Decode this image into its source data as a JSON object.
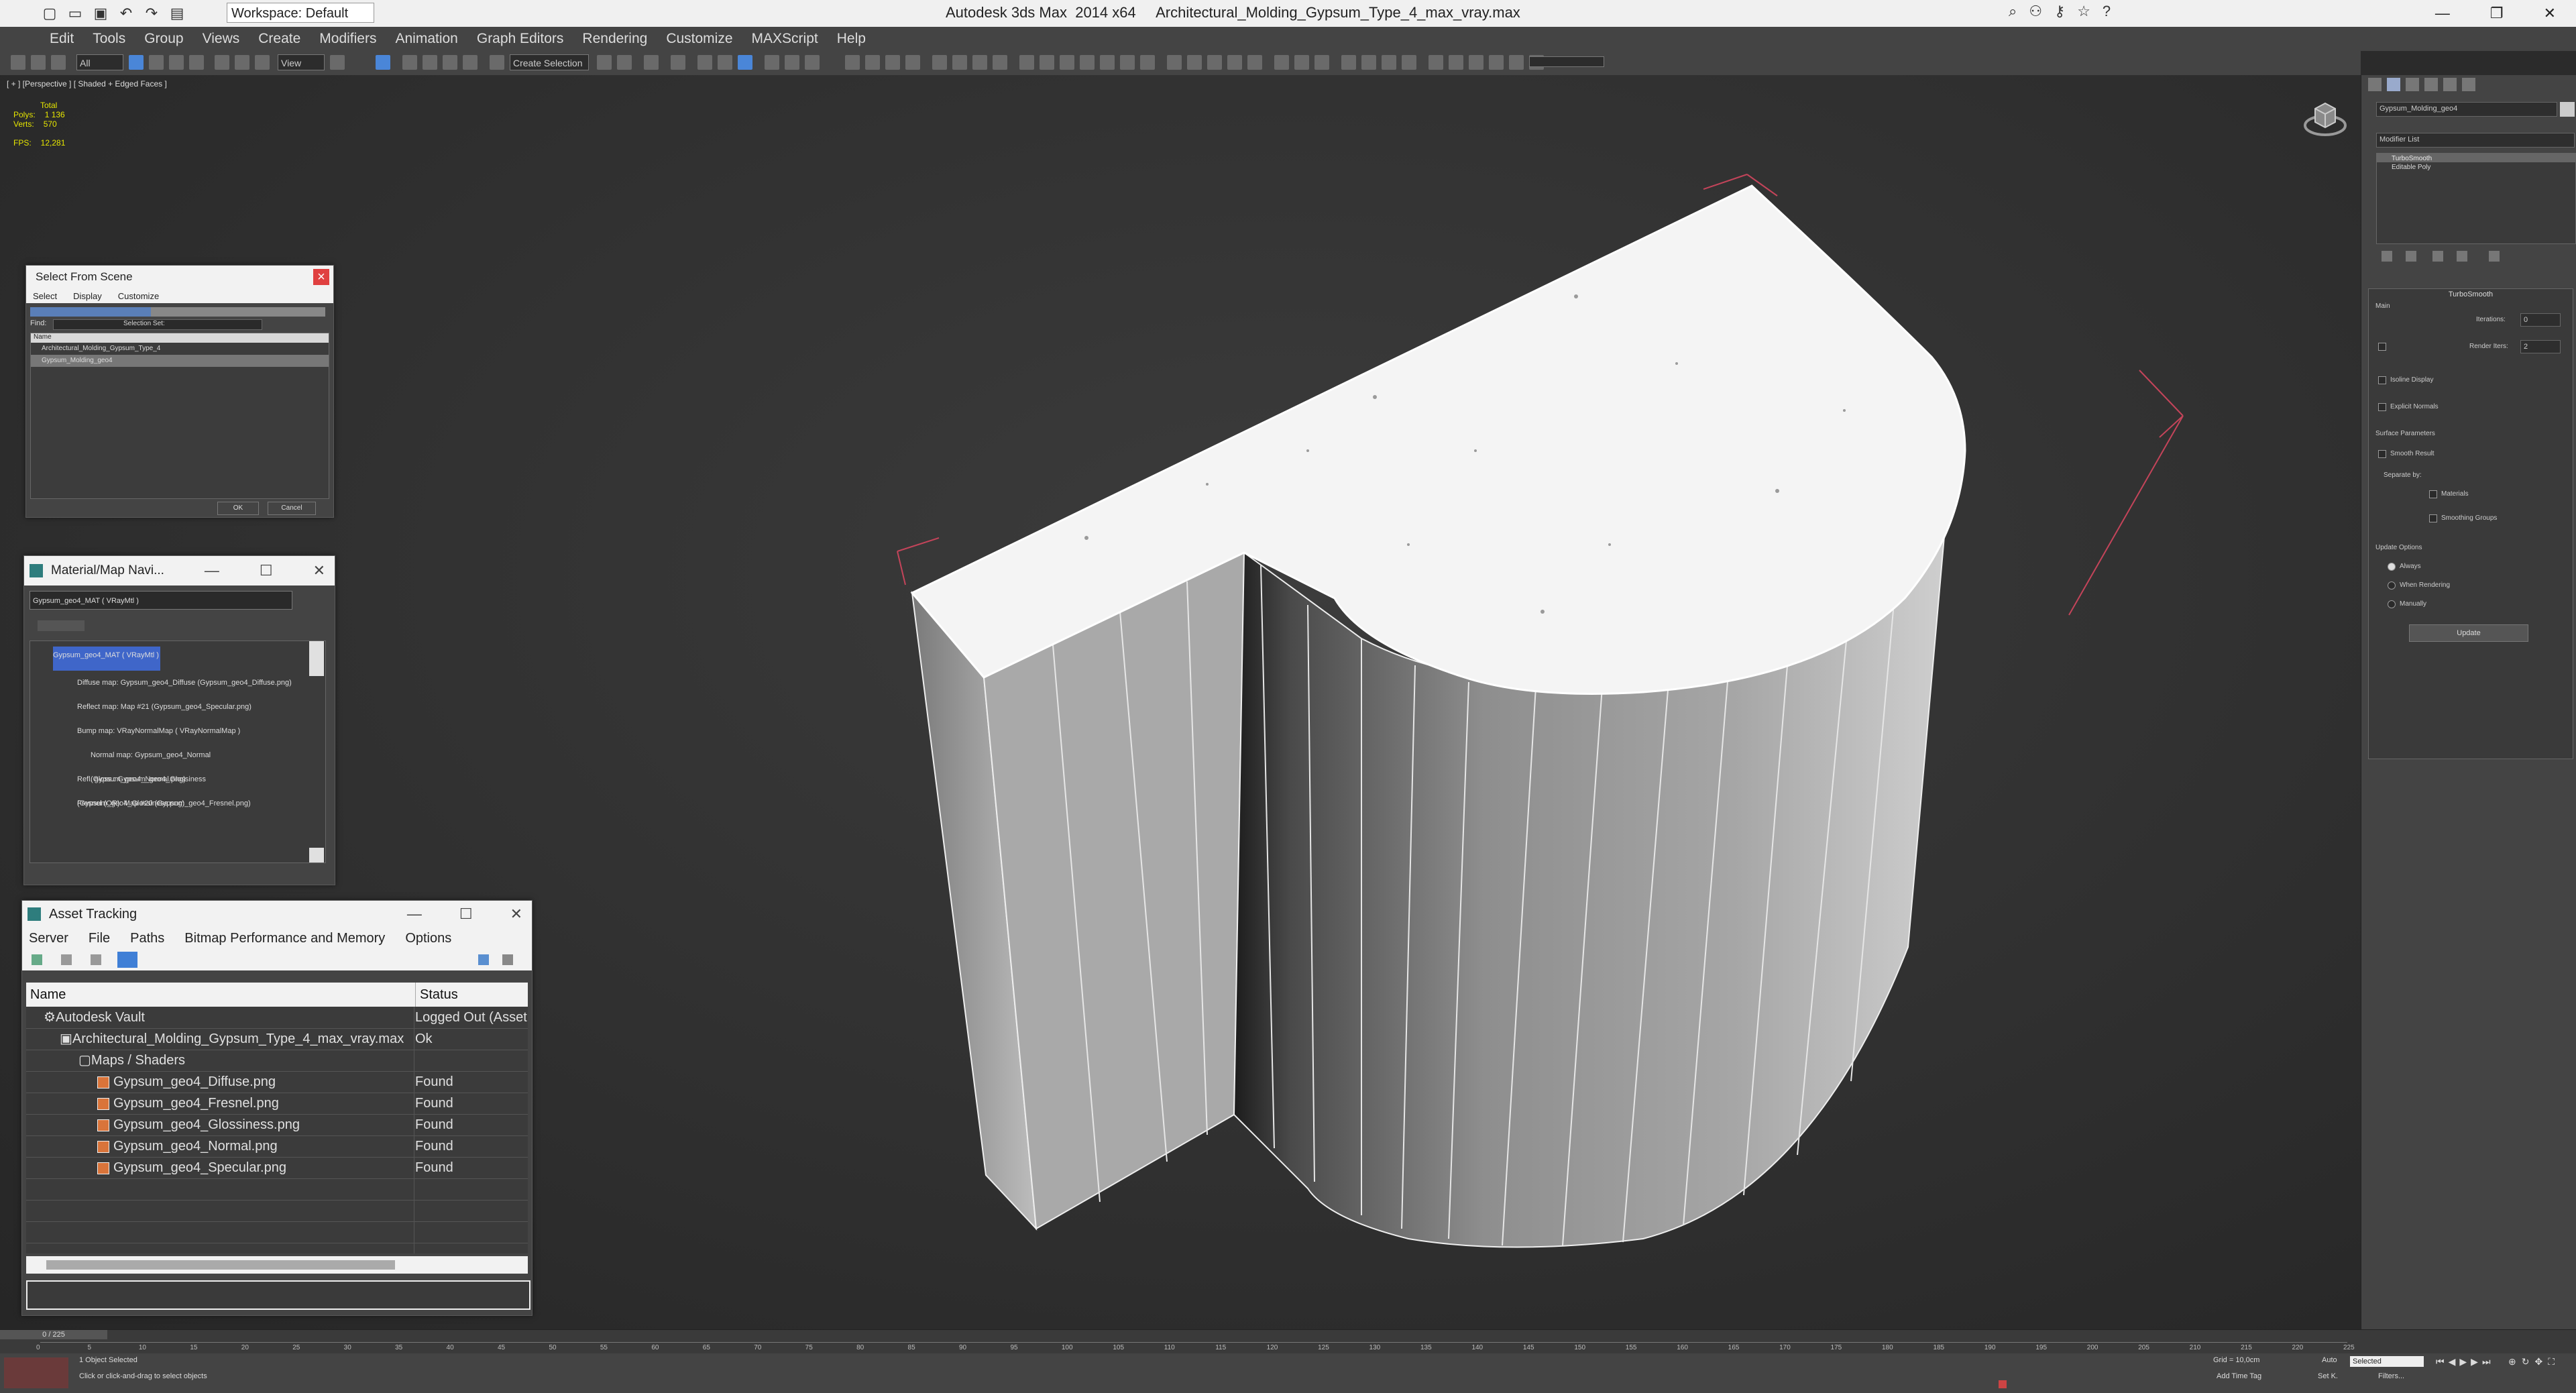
{
  "app": {
    "title": "Autodesk 3ds Max  2014 x64     Architectural_Molding_Gypsum_Type_4_max_vray.max",
    "workspace": "Workspace: Default"
  },
  "menu": [
    "Edit",
    "Tools",
    "Group",
    "Views",
    "Create",
    "Modifiers",
    "Animation",
    "Graph Editors",
    "Rendering",
    "Customize",
    "MAXScript",
    "Help"
  ],
  "toolbar": {
    "filter": "All",
    "refcoord": "View",
    "selset": "Create Selection Se"
  },
  "viewport": {
    "label": "[ + ] [Perspective ] [ Shaded + Edged Faces ]",
    "stats": {
      "total_label": "Total",
      "polys_label": "Polys:",
      "polys": "1 136",
      "verts_label": "Verts:",
      "verts": "570",
      "fps_label": "FPS:",
      "fps": "12,281"
    }
  },
  "select_from_scene": {
    "title": "Select From Scene",
    "close": "×",
    "menu": [
      "Select",
      "Display",
      "Customize"
    ],
    "find_label": "Find:",
    "selset_label": "Selection Set:",
    "col_name": "Name",
    "items": [
      "Architectural_Molding_Gypsum_Type_4",
      "Gypsum_Molding_geo4"
    ],
    "ok": "OK",
    "cancel": "Cancel"
  },
  "material_navigator": {
    "title": "Material/Map Navi...",
    "field": "Gypsum_geo4_MAT  ( VRayMtl )",
    "items": [
      "Gypsum_geo4_MAT  ( VRayMtl )",
      "Diffuse map: Gypsum_geo4_Diffuse (Gypsum_geo4_Diffuse.png)",
      "Reflect map: Map #21 (Gypsum_geo4_Specular.png)",
      "Bump map: VRayNormalMap  ( VRayNormalMap )",
      "Normal map: Gypsum_geo4_Normal (Gypsum_geo4_Normal.png)",
      "Refl. gloss.: Gypsum_geo4_Glossiness (Gypsum_geo4_Glossiness.png)",
      "Fresnel (OR): Map #20 (Gypsum_geo4_Fresnel.png)"
    ]
  },
  "asset_tracking": {
    "title": "Asset Tracking",
    "menu": [
      "Server",
      "File",
      "Paths",
      "Bitmap Performance and Memory",
      "Options"
    ],
    "col_name": "Name",
    "col_status": "Status",
    "rows": [
      {
        "name": "Autodesk Vault",
        "status": "Logged Out (Asset",
        "level": 0
      },
      {
        "name": "Architectural_Molding_Gypsum_Type_4_max_vray.max",
        "status": "Ok",
        "level": 1
      },
      {
        "name": "Maps / Shaders",
        "status": "",
        "level": 2
      },
      {
        "name": "Gypsum_geo4_Diffuse.png",
        "status": "Found",
        "level": 3
      },
      {
        "name": "Gypsum_geo4_Fresnel.png",
        "status": "Found",
        "level": 3
      },
      {
        "name": "Gypsum_geo4_Glossiness.png",
        "status": "Found",
        "level": 3
      },
      {
        "name": "Gypsum_geo4_Normal.png",
        "status": "Found",
        "level": 3
      },
      {
        "name": "Gypsum_geo4_Specular.png",
        "status": "Found",
        "level": 3
      }
    ]
  },
  "command_panel": {
    "object_name": "Gypsum_Molding_geo4",
    "modifier_list": "Modifier List",
    "stack": [
      "TurboSmooth",
      "Editable Poly"
    ],
    "rollout_title": "TurboSmooth",
    "main_label": "Main",
    "iterations_label": "Iterations:",
    "iterations": "0",
    "render_iters_label": "Render Iters:",
    "render_iters": "2",
    "isoline": "Isoline Display",
    "explicit_normals": "Explicit Normals",
    "surface_params": "Surface Parameters",
    "smooth_result": "Smooth Result",
    "separate_by": "Separate by:",
    "materials": "Materials",
    "smoothing_groups": "Smoothing Groups",
    "update_options": "Update Options",
    "always": "Always",
    "when_rendering": "When Rendering",
    "manually": "Manually",
    "update_btn": "Update"
  },
  "timeline": {
    "frame": "0 / 225",
    "ticks": [
      "0",
      "5",
      "10",
      "15",
      "20",
      "25",
      "30",
      "35",
      "40",
      "45",
      "50",
      "55",
      "60",
      "65",
      "70",
      "75",
      "80",
      "85",
      "90",
      "95",
      "100",
      "105",
      "110",
      "115",
      "120",
      "125",
      "130",
      "135",
      "140",
      "145",
      "150",
      "155",
      "160",
      "165",
      "170",
      "175",
      "180",
      "185",
      "190",
      "195",
      "200",
      "205",
      "210",
      "215",
      "220",
      "225"
    ]
  },
  "status": {
    "selected": "1 Object Selected",
    "hint": "Click or click-and-drag to select objects",
    "grid": "Grid = 10,0cm",
    "auto": "Auto",
    "selected_dd": "Selected",
    "setk": "Set K.",
    "filters": "Filters...",
    "add_time_tag": "Add Time Tag"
  }
}
